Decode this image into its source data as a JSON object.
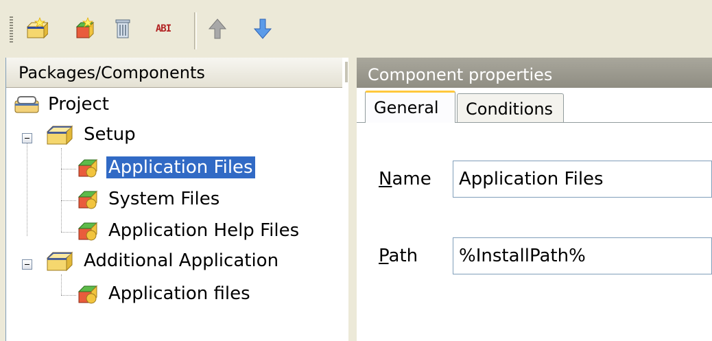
{
  "toolbar": {
    "buttons": [
      {
        "icon": "new-package-icon"
      },
      {
        "icon": "new-component-icon"
      },
      {
        "icon": "delete-icon"
      },
      {
        "icon": "rename-icon",
        "glyph": "ABI"
      },
      {
        "icon": "move-up-icon"
      },
      {
        "icon": "move-down-icon"
      }
    ]
  },
  "left_pane": {
    "header": "Packages/Components",
    "tree": {
      "root": "Project",
      "packages": [
        {
          "label": "Setup",
          "components": [
            "Application Files",
            "System Files",
            "Application Help Files"
          ]
        },
        {
          "label": "Additional Application",
          "components": [
            "Application files"
          ]
        }
      ],
      "selected": "Application Files"
    }
  },
  "right_pane": {
    "header": "Component properties",
    "tabs": [
      "General",
      "Conditions"
    ],
    "active_tab": "General",
    "fields": {
      "name": {
        "label_prefix": "N",
        "label_rest": "ame",
        "value": "Application Files"
      },
      "path": {
        "label_prefix": "P",
        "label_rest": "ath",
        "value": "%InstallPath%"
      }
    }
  },
  "colors": {
    "selection": "#316AC5",
    "window_bg": "#ECE9D8",
    "active_tab_accent": "#FFC83C",
    "header_bg": "#9C9A8F"
  }
}
